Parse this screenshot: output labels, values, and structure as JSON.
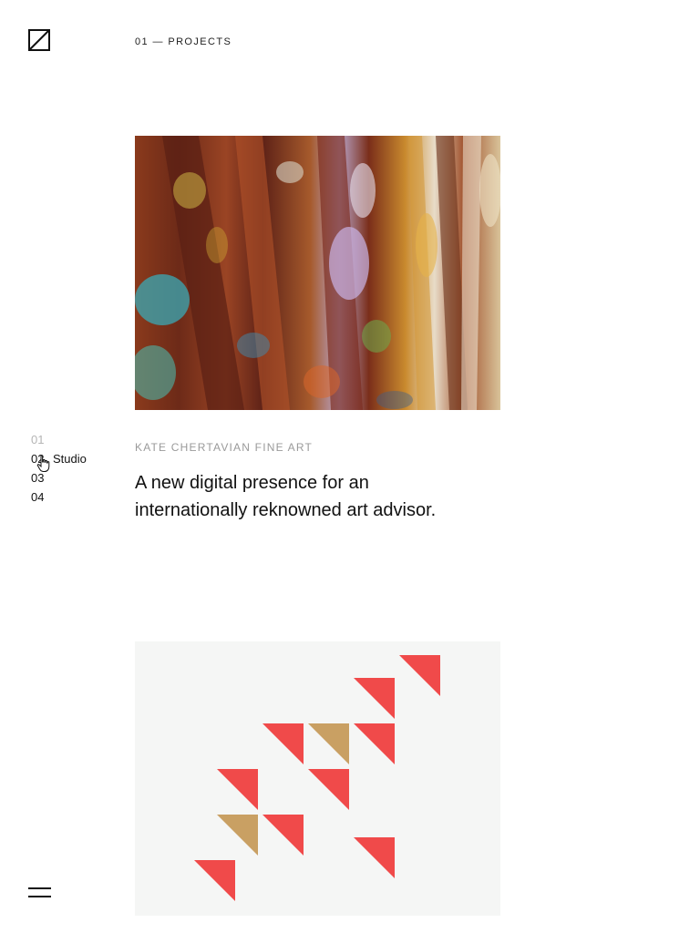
{
  "header": {
    "section_label": "01 — PROJECTS",
    "logo_icon": "square-diagonal-logo-icon"
  },
  "nav": {
    "items": [
      {
        "num": "01",
        "label": "",
        "state": "inactive"
      },
      {
        "num": "02",
        "label": "Studio",
        "state": "hover"
      },
      {
        "num": "03",
        "label": "",
        "state": "normal"
      },
      {
        "num": "04",
        "label": "",
        "state": "normal"
      }
    ]
  },
  "projects": [
    {
      "image": "textured-abstract-painting",
      "client": "KATE CHERTAVIAN FINE ART",
      "headline_line1": "A new digital presence for an",
      "headline_line2": "internationally reknowned art advisor."
    },
    {
      "image": "red-and-gold-triangle-pattern",
      "triangle_colors": {
        "red": "#f04a4a",
        "gold": "#c9a063"
      }
    }
  ],
  "menu": {
    "icon": "hamburger-menu-icon"
  },
  "cursor": {
    "icon": "pointer-hand-icon"
  }
}
